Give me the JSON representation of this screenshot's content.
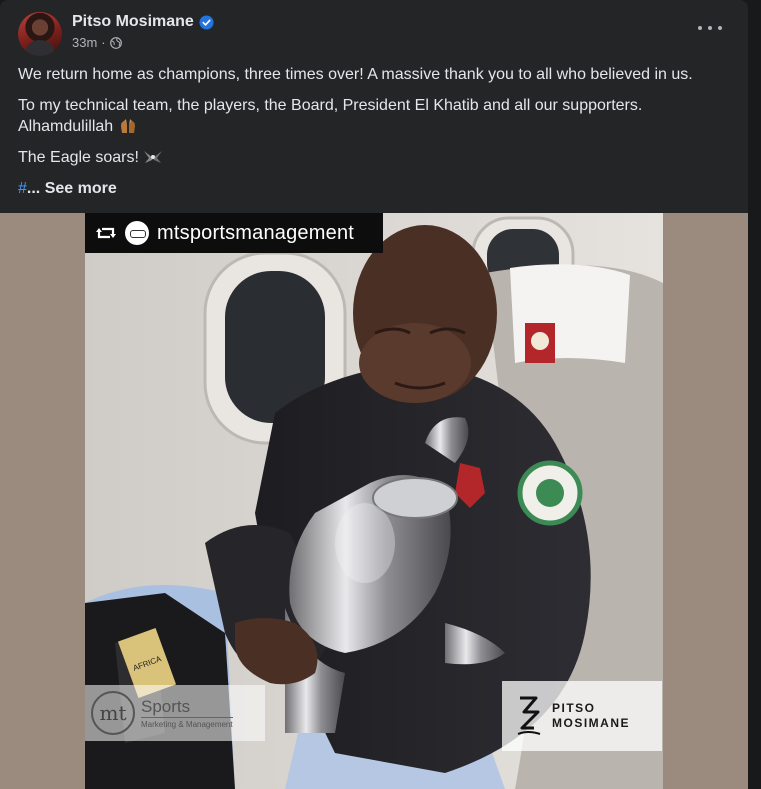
{
  "post": {
    "author": "Pitso Mosimane",
    "time": "33m",
    "separator": "·",
    "paragraphs": [
      "We return home as champions, three times over! A massive thank you to all who believed in us.",
      "To my technical team, the players, the Board, President El Khatib and all our supporters. Alhamdulillah",
      "The Eagle soars!"
    ],
    "hashtag": "#",
    "see_more_label": "... See more"
  },
  "media": {
    "repost_handle": "mtsportsmanagement",
    "watermark_left_line1": "Sports",
    "watermark_left_line2": "Marketing & Management",
    "watermark_left_monogram": "mt",
    "watermark_right_line1": "PITSO",
    "watermark_right_line2": "MOSIMANE",
    "trophy_plate_text": "AFRICA"
  },
  "colors": {
    "background": "#18191a",
    "card": "#242526",
    "primary_text": "#e4e6eb",
    "secondary_text": "#b0b3b8",
    "link": "#4599ff",
    "verified": "#2374e1"
  },
  "icons": {
    "verified": "verified-badge-icon",
    "privacy": "globe-icon",
    "menu": "more-options-icon",
    "praying_hands": "folded-hands-emoji",
    "eagle": "eagle-emoji",
    "repost": "repost-icon"
  }
}
